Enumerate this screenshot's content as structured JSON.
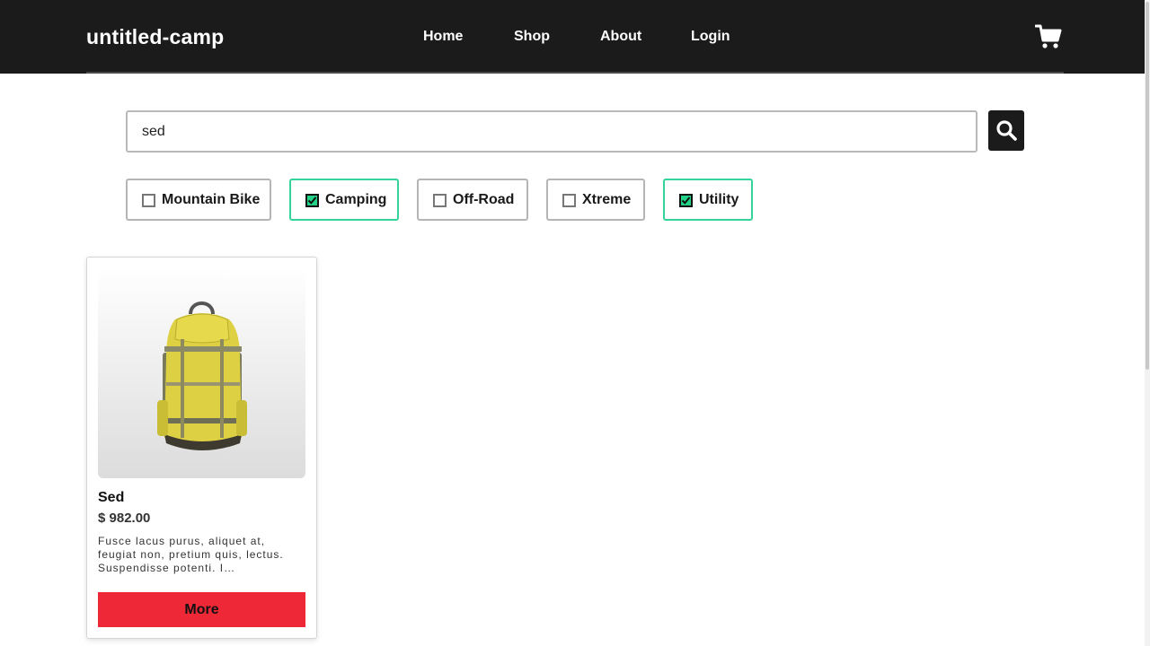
{
  "app": {
    "logo": "untitled-camp"
  },
  "nav": {
    "items": [
      {
        "label": "Home"
      },
      {
        "label": "Shop"
      },
      {
        "label": "About"
      },
      {
        "label": "Login"
      }
    ],
    "cart_icon": "shopping-cart-icon"
  },
  "search": {
    "value": "sed",
    "placeholder": "",
    "button_icon": "search-icon"
  },
  "filters": [
    {
      "label": "Mountain Bike",
      "checked": false
    },
    {
      "label": "Camping",
      "checked": true
    },
    {
      "label": "Off-Road",
      "checked": false
    },
    {
      "label": "Xtreme",
      "checked": false
    },
    {
      "label": "Utility",
      "checked": true
    }
  ],
  "products": [
    {
      "title": "Sed",
      "price": "$ 982.00",
      "description": "Fusce lacus purus, aliquet at, feugiat non, pretium quis, lectus. Suspendisse potenti. I…",
      "button_label": "More",
      "image": "yellow-backpack"
    }
  ],
  "colors": {
    "header_bg": "#1b1b1b",
    "checked_border": "#34d399",
    "checkbox_fill": "#22d387",
    "more_button": "#ee2837"
  }
}
